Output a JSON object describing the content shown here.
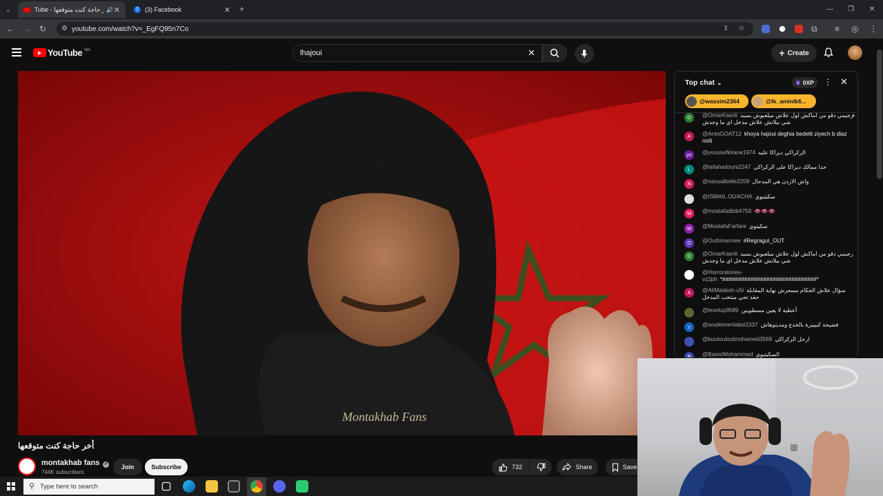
{
  "browser": {
    "tabs": [
      {
        "title": "Tube - أخر حاجة كنت متوقعها",
        "audio": "🔊",
        "active": true
      },
      {
        "title": "(3) Facebook",
        "active": false
      }
    ],
    "new_tab": "+",
    "url": "youtube.com/watch?v=_EgFQ95n7Co"
  },
  "youtube": {
    "logo": "YouTube",
    "region": "MA",
    "search_value": "lhajoui",
    "create_label": "Create"
  },
  "video": {
    "title": "أخر حاجة كنت متوقعها",
    "hoodie_text": "Montakhab Fans"
  },
  "channel": {
    "name": "montakhab fans",
    "verified": "✔",
    "subscribers": "744K subscribers",
    "join_label": "Join",
    "subscribe_label": "Subscribe"
  },
  "actions": {
    "likes": "732",
    "share_label": "Share",
    "save_label": "Save"
  },
  "chat": {
    "mode": "Top chat",
    "points": "0XP",
    "tickers": [
      "@wassim2364",
      "@lk_aminlk6..."
    ],
    "messages": [
      {
        "initial": "O",
        "color": "#2e7d32",
        "author": "@OmarKasriii",
        "text": "رجيمي دقو من اماكش لول علاش ميلعبوش بسيد شي بيلاتش علاش مدخل اي ما وجدش"
      },
      {
        "initial": "A",
        "color": "#c2185b",
        "author": "@AntoGOAT12",
        "text": "khoya hajoui deghia bedelti ziyech b diaz nsiti"
      },
      {
        "initial": "yo",
        "color": "#6a1b9a",
        "author": "@youssefkirane1974",
        "text": "الركراكي ديراكا عليه"
      },
      {
        "initial": "L",
        "color": "#00897b",
        "author": "@lailahadouni2247",
        "text": "حدا ممالك ديراكا على الركراكي"
      },
      {
        "initial": "N",
        "color": "#d81b60",
        "author": "@naoualbelle2209",
        "text": "واش الاردن هي المدحال"
      },
      {
        "initial": "",
        "color": "#dddddd",
        "author": "@ISMAIL.OUACHA",
        "text": "سكيتيوي"
      },
      {
        "initial": "M",
        "color": "#e91e63",
        "author": "@mostafadbib4759",
        "text": "👄👄👄"
      },
      {
        "initial": "M",
        "color": "#8e24aa",
        "author": "@MustafaFarfare",
        "text": "سكيتوي"
      },
      {
        "initial": "O",
        "color": "#5e35b1",
        "author": "@Outhmannee",
        "text": "#Regragui_OUT"
      },
      {
        "initial": "O",
        "color": "#2e7d32",
        "author": "@OmarKasriii",
        "text": "رجيمي دقو من اماكش لول علاش ميلعبوش بسيد شي بيلاتش علاش مدخل اي ما وجدش"
      },
      {
        "initial": "",
        "color": "#ffffff",
        "author": "@Horrorstories-vz2ph",
        "text": "*##############################*"
      },
      {
        "initial": "A",
        "color": "#c2185b",
        "author": "@AliMasbah-u5i",
        "text": "سؤال علاش الحكام مسعرش نهاية المقابلة حقد تحي منتخب المدخل"
      },
      {
        "initial": "",
        "color": "#556b2f",
        "author": "@levelup9589",
        "text": "أعطية لا يعين مسطوبين"
      },
      {
        "initial": "s",
        "color": "#1565c0",
        "author": "@souleimenlabsi2337",
        "text": "فضيحة كبيييرة بالخدع ومديتوهاش"
      },
      {
        "initial": "",
        "color": "#3f51b5",
        "author": "@boutouloutmohamed3569",
        "text": "ارحل الركراكي"
      },
      {
        "initial": "B",
        "color": "#3949ab",
        "author": "@BawxiMohammed",
        "text": "السكيتيوي"
      }
    ]
  },
  "taskbar": {
    "search_placeholder": "Type here to search"
  }
}
